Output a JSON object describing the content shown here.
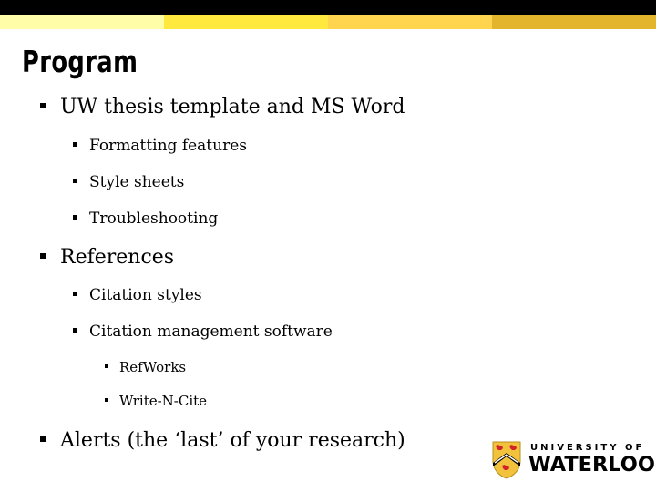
{
  "header": {
    "stripe_colors": [
      "#000000",
      "#fffda8",
      "#ffe93f",
      "#ffd54f",
      "#e2b52c"
    ]
  },
  "slide": {
    "title": "Program",
    "items": [
      {
        "level": 1,
        "text": "UW thesis template and MS Word"
      },
      {
        "level": 2,
        "text": "Formatting features"
      },
      {
        "level": 2,
        "text": "Style sheets"
      },
      {
        "level": 2,
        "text": "Troubleshooting"
      },
      {
        "level": 1,
        "text": "References"
      },
      {
        "level": 2,
        "text": "Citation styles"
      },
      {
        "level": 2,
        "text": "Citation management software"
      },
      {
        "level": 3,
        "text": "RefWorks"
      },
      {
        "level": 3,
        "text": "Write-N-Cite"
      },
      {
        "level": 1,
        "text": "Alerts (the ‘last’ of your research)"
      }
    ]
  },
  "logo": {
    "line1": "UNIVERSITY OF",
    "line2": "WATERLOO",
    "shield_icon": "university-crest-icon",
    "colors": {
      "gold": "#f3c23c",
      "red": "#d2232a",
      "black": "#000000"
    }
  }
}
